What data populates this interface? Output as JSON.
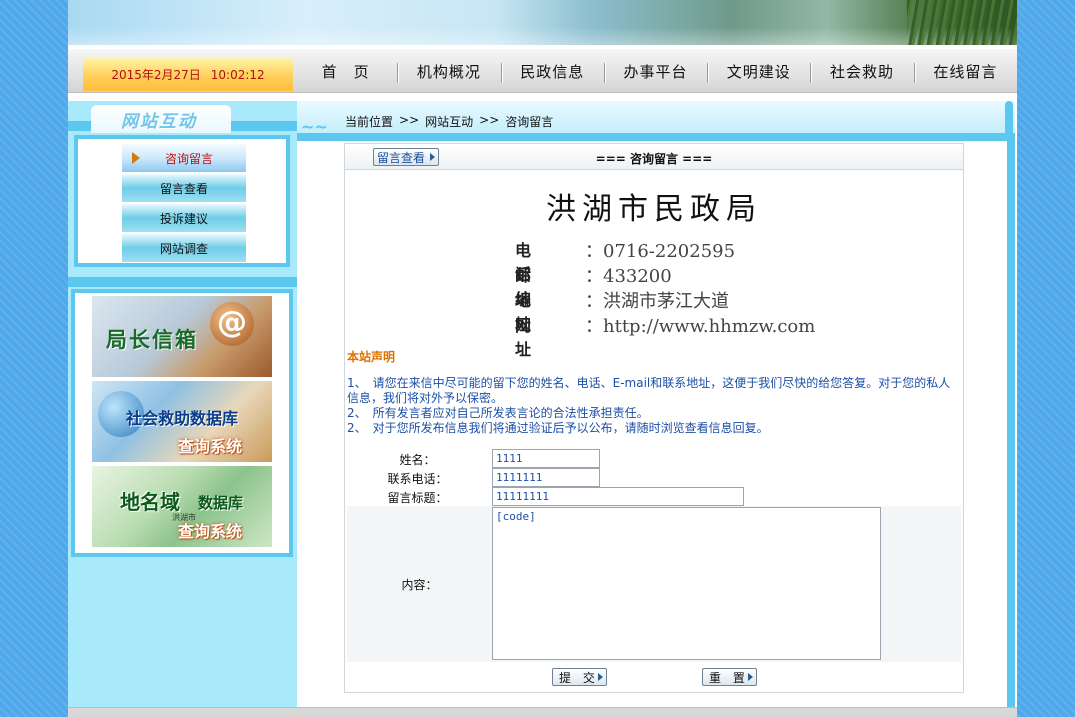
{
  "header": {
    "date": "2015年2月27日",
    "time": "10:02:12"
  },
  "nav": {
    "items": [
      {
        "label": "首　页"
      },
      {
        "label": "机构概况"
      },
      {
        "label": "民政信息"
      },
      {
        "label": "办事平台"
      },
      {
        "label": "文明建设"
      },
      {
        "label": "社会救助"
      },
      {
        "label": "在线留言"
      }
    ]
  },
  "sidebar": {
    "title": "网站互动",
    "items": [
      {
        "label": "咨询留言",
        "active": true
      },
      {
        "label": "留言查看"
      },
      {
        "label": "投诉建议"
      },
      {
        "label": "网站调查"
      }
    ],
    "promos": [
      {
        "title": "局长信箱",
        "icon": "at-icon"
      },
      {
        "title": "社会救助数据库",
        "subtitle": "查询系统"
      },
      {
        "title": "地名域",
        "title_b": "数据库",
        "subtitle": "查询系统",
        "map_label": "洪湖市"
      }
    ]
  },
  "breadcrumb": {
    "prefix": "当前位置",
    "sep": ">>",
    "level1": "网站互动",
    "level2": "咨询留言"
  },
  "content": {
    "view_button": "留言查看",
    "title": "=== 咨询留言 ===",
    "org_name": "洪湖市民政局",
    "contacts": [
      {
        "key": "电　话",
        "value": "：0716-2202595"
      },
      {
        "key": "邮　编",
        "value": "：433200"
      },
      {
        "key": "地　址",
        "value": "：洪湖市茅江大道"
      },
      {
        "key": "网　址",
        "value": "：http://www.hhmzw.com"
      }
    ],
    "notice_title": "本站声明",
    "notice_lines": [
      "1、　请您在来信中尽可能的留下您的姓名、电话、E-mail和联系地址，这便于我们尽快的给您答复。对于您的私人信息，我们将对外予以保密。",
      "2、　所有发言者应对自己所发表言论的合法性承担责任。",
      "2、　对于您所发布信息我们将通过验证后予以公布，请随时浏览查看信息回复。"
    ]
  },
  "form": {
    "name_label": "姓名：",
    "name_value": "1111",
    "phone_label": "联系电话：",
    "phone_value": "1111111",
    "subject_label": "留言标题：",
    "subject_value": "11111111",
    "content_label": "内容：",
    "content_value": "[code]",
    "submit_label": "提 交",
    "reset_label": "重 置"
  }
}
